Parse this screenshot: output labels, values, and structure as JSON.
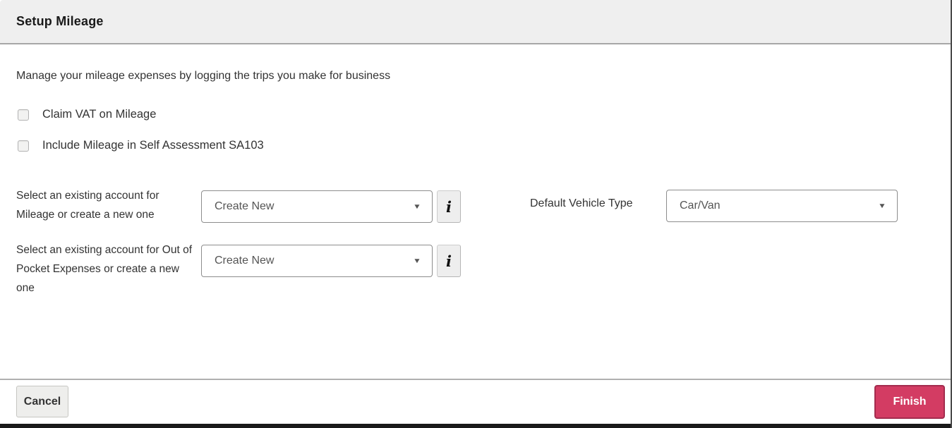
{
  "dialog": {
    "title": "Setup Mileage",
    "intro": "Manage your mileage expenses by logging the trips you make for business"
  },
  "checkboxes": [
    {
      "label": "Claim VAT on Mileage",
      "checked": false
    },
    {
      "label": "Include Mileage in Self Assessment SA103",
      "checked": false
    }
  ],
  "fields": {
    "mileage_account": {
      "label": "Select an existing account for Mileage or create a new one",
      "value": "Create New"
    },
    "default_vehicle_type": {
      "label": "Default Vehicle Type",
      "value": "Car/Van"
    },
    "out_of_pocket_account": {
      "label": "Select an existing account for Out of Pocket Expenses or create a new one",
      "value": "Create New"
    }
  },
  "icons": {
    "dropdown_arrow": "▼",
    "info_glyph": "i"
  },
  "footer": {
    "cancel_label": "Cancel",
    "finish_label": "Finish"
  },
  "colors": {
    "header_bg": "#efefef",
    "finish_bg": "#d33c63",
    "finish_border": "#a32c4e",
    "text": "#333333",
    "select_border": "#8d8d8d"
  }
}
